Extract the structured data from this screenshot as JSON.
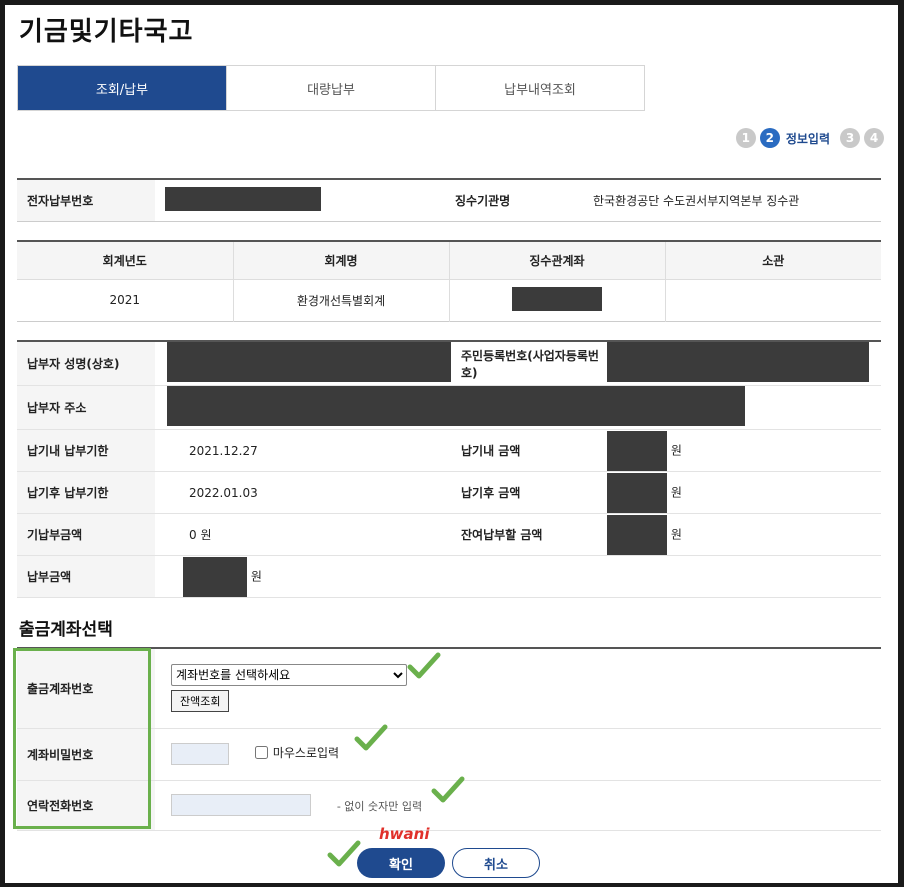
{
  "page": {
    "title": "기금및기타국고"
  },
  "tabs": [
    {
      "label": "조회/납부",
      "active": true
    },
    {
      "label": "대량납부",
      "active": false
    },
    {
      "label": "납부내역조회",
      "active": false
    }
  ],
  "steps": {
    "numbers": [
      "1",
      "2",
      "3",
      "4"
    ],
    "current_label": "정보입력"
  },
  "info": {
    "ebill_label": "전자납부번호",
    "agency_label": "징수기관명",
    "agency_value": "한국환경공단 수도권서부지역본부 징수관"
  },
  "account_table": {
    "headers": [
      "회계년도",
      "회계명",
      "징수관계좌",
      "소관"
    ],
    "row": [
      "2021",
      "환경개선특별회계",
      "",
      ""
    ]
  },
  "payer": {
    "name_label": "납부자 성명(상호)",
    "regno_label": "주민등록번호(사업자등록번호)",
    "address_label": "납부자 주소",
    "due_label": "납기내 납부기한",
    "due_value": "2021.12.27",
    "due_amount_label": "납기내 금액",
    "after_label": "납기후 납부기한",
    "after_value": "2022.01.03",
    "after_amount_label": "납기후 금액",
    "paid_label": "기납부금액",
    "paid_value": "0 원",
    "remain_label": "잔여납부할 금액",
    "amount_label": "납부금액",
    "won": "원"
  },
  "withdraw": {
    "section_title": "출금계좌선택",
    "account_label": "출금계좌번호",
    "account_select": "계좌번호를 선택하세요",
    "balance_button": "잔액조회",
    "password_label": "계좌비밀번호",
    "mouse_input_label": "마우스로입력",
    "phone_label": "연락전화번호",
    "phone_hint": "- 없이 숫자만 입력"
  },
  "buttons": {
    "confirm": "확인",
    "cancel": "취소"
  },
  "watermark": "hwani",
  "colors": {
    "primary": "#1f4a8f",
    "annotation": "#6ab04c",
    "watermark": "#e0302a"
  }
}
